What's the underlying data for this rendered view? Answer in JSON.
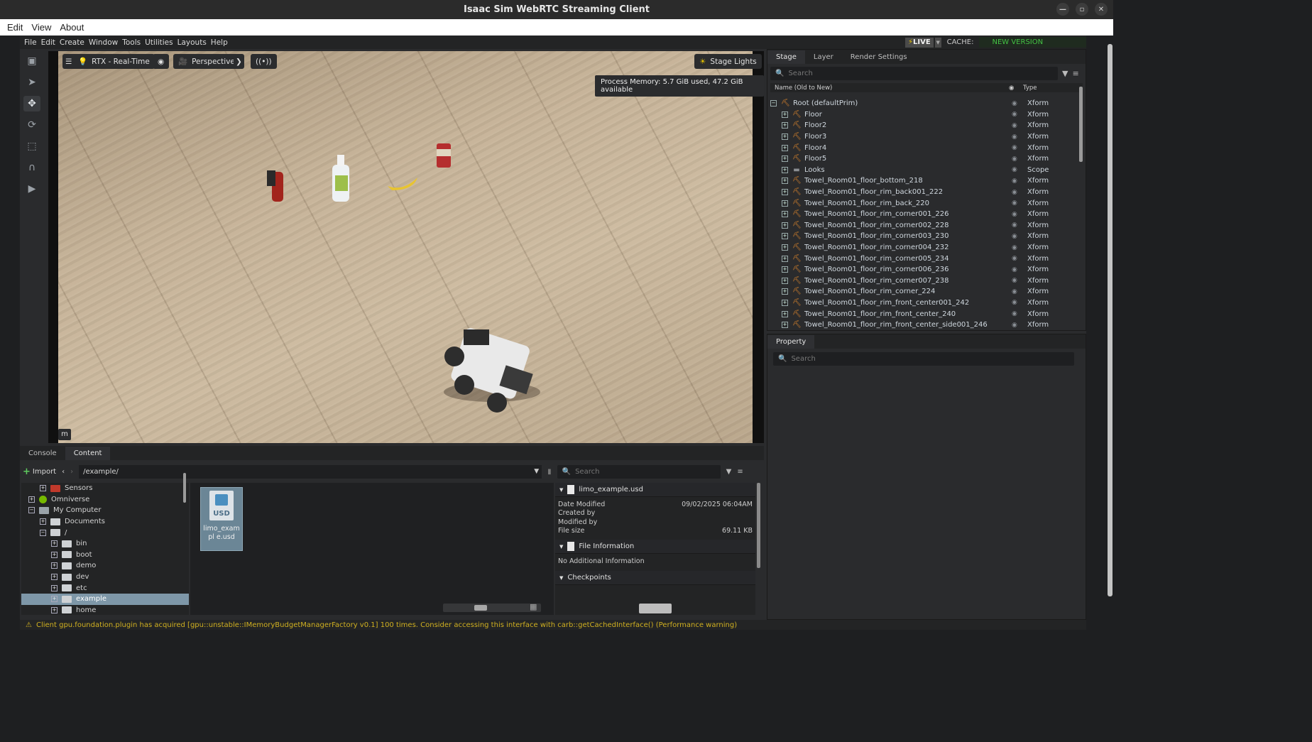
{
  "window": {
    "title": "Isaac Sim WebRTC Streaming Client"
  },
  "browser_menu": [
    "Edit",
    "View",
    "About"
  ],
  "app_menu": [
    "File",
    "Edit",
    "Create",
    "Window",
    "Tools",
    "Utilities",
    "Layouts",
    "Help"
  ],
  "status_top": {
    "live": "LIVE",
    "cache_label": "CACHE:",
    "cache_value": "NEW VERSION DETECTED"
  },
  "viewport": {
    "render_mode": "RTX - Real-Time",
    "camera": "Perspective",
    "lights": "Stage Lights",
    "process_memory": "Process Memory: 5.7 GiB used, 47.2 GiB available",
    "units": "m"
  },
  "stage": {
    "tabs": [
      "Stage",
      "Layer",
      "Render Settings"
    ],
    "search_placeholder": "Search",
    "col_name": "Name (Old to New)",
    "col_type": "Type",
    "rows": [
      {
        "name": "Root (defaultPrim)",
        "type": "Xform"
      },
      {
        "name": "Floor",
        "type": "Xform"
      },
      {
        "name": "Floor2",
        "type": "Xform"
      },
      {
        "name": "Floor3",
        "type": "Xform"
      },
      {
        "name": "Floor4",
        "type": "Xform"
      },
      {
        "name": "Floor5",
        "type": "Xform"
      },
      {
        "name": "Looks",
        "type": "Scope"
      },
      {
        "name": "Towel_Room01_floor_bottom_218",
        "type": "Xform"
      },
      {
        "name": "Towel_Room01_floor_rim_back001_222",
        "type": "Xform"
      },
      {
        "name": "Towel_Room01_floor_rim_back_220",
        "type": "Xform"
      },
      {
        "name": "Towel_Room01_floor_rim_corner001_226",
        "type": "Xform"
      },
      {
        "name": "Towel_Room01_floor_rim_corner002_228",
        "type": "Xform"
      },
      {
        "name": "Towel_Room01_floor_rim_corner003_230",
        "type": "Xform"
      },
      {
        "name": "Towel_Room01_floor_rim_corner004_232",
        "type": "Xform"
      },
      {
        "name": "Towel_Room01_floor_rim_corner005_234",
        "type": "Xform"
      },
      {
        "name": "Towel_Room01_floor_rim_corner006_236",
        "type": "Xform"
      },
      {
        "name": "Towel_Room01_floor_rim_corner007_238",
        "type": "Xform"
      },
      {
        "name": "Towel_Room01_floor_rim_corner_224",
        "type": "Xform"
      },
      {
        "name": "Towel_Room01_floor_rim_front_center001_242",
        "type": "Xform"
      },
      {
        "name": "Towel_Room01_floor_rim_front_center_240",
        "type": "Xform"
      },
      {
        "name": "Towel_Room01_floor_rim_front_center_side001_246",
        "type": "Xform"
      }
    ]
  },
  "property": {
    "tab": "Property",
    "search_placeholder": "Search"
  },
  "bottom": {
    "tabs": [
      "Console",
      "Content"
    ],
    "import_label": "Import",
    "path": "/example/",
    "search_placeholder": "Search",
    "tree": [
      {
        "label": "Sensors",
        "kind": "sensor"
      },
      {
        "label": "Omniverse",
        "kind": "omni"
      },
      {
        "label": "My Computer",
        "kind": "pc"
      },
      {
        "label": "Documents",
        "kind": "folder"
      },
      {
        "label": "/",
        "kind": "folder"
      },
      {
        "label": "bin",
        "kind": "folder"
      },
      {
        "label": "boot",
        "kind": "folder"
      },
      {
        "label": "demo",
        "kind": "folder"
      },
      {
        "label": "dev",
        "kind": "folder"
      },
      {
        "label": "etc",
        "kind": "folder"
      },
      {
        "label": "example",
        "kind": "folder"
      },
      {
        "label": "home",
        "kind": "folder"
      }
    ],
    "file": {
      "name": "limo_example.usd",
      "icon_text": "USD",
      "tile_label": "limo_exampl e.usd"
    },
    "details": {
      "filename": "limo_example.usd",
      "date_modified_label": "Date Modified",
      "date_modified": "09/02/2025 06:04AM",
      "created_by_label": "Created by",
      "modified_by_label": "Modified by",
      "file_size_label": "File size",
      "file_size": "69.11 KB",
      "file_info_title": "File Information",
      "file_info_text": "No Additional Information",
      "checkpoints_title": "Checkpoints"
    }
  },
  "status_bar": {
    "message": "Client gpu.foundation.plugin has acquired [gpu::unstable::IMemoryBudgetManagerFactory v0.1] 100 times. Consider accessing this interface with carb::getCachedInterface() (Performance warning)"
  },
  "colors": {
    "accent_live": "#e8c400",
    "new_version": "#44c244",
    "xform_icon": "#e58a2c",
    "selected_row": "#7e97a8",
    "warning": "#d0b020"
  }
}
